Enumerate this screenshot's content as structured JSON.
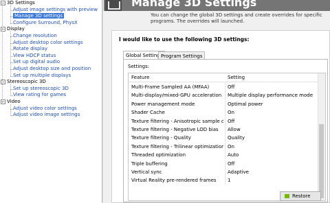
{
  "nav": {
    "categories": [
      {
        "label": "3D Settings",
        "items": [
          "Adjust image settings with preview",
          "Manage 3D settings",
          "Configure Surround, PhysX"
        ]
      },
      {
        "label": "Display",
        "items": [
          "Change resolution",
          "Adjust desktop color settings",
          "Rotate display",
          "View HDCP status",
          "Set up digital audio",
          "Adjust desktop size and position",
          "Set up multiple displays"
        ]
      },
      {
        "label": "Stereoscopic 3D",
        "items": [
          "Set up stereoscopic 3D",
          "View rating for games"
        ]
      },
      {
        "label": "Video",
        "items": [
          "Adjust video color settings",
          "Adjust video image settings"
        ]
      }
    ],
    "selected": "Manage 3D settings"
  },
  "header": {
    "title": "Manage 3D Settings",
    "description": "You can change the global 3D settings and create overrides for specific programs. The overrides will launched."
  },
  "panel": {
    "question": "I would like to use the following 3D settings:",
    "tabs": [
      "Global Settings",
      "Program Settings"
    ],
    "active_tab": "Global Settings",
    "settings_label": "Settings:",
    "columns": [
      "Feature",
      "Setting"
    ],
    "rows": [
      {
        "feature": "Multi-Frame Sampled AA (MFAA)",
        "setting": "Off"
      },
      {
        "feature": "Multi-display/mixed-GPU acceleration",
        "setting": "Multiple display performance mode"
      },
      {
        "feature": "Power management mode",
        "setting": "Optimal power"
      },
      {
        "feature": "Shader Cache",
        "setting": "On"
      },
      {
        "feature": "Texture filtering - Anisotropic sample opti...",
        "setting": "Off"
      },
      {
        "feature": "Texture filtering - Negative LOD bias",
        "setting": "Allow"
      },
      {
        "feature": "Texture filtering - Quality",
        "setting": "Quality"
      },
      {
        "feature": "Texture filtering - Trilinear optimization",
        "setting": "On"
      },
      {
        "feature": "Threaded optimization",
        "setting": "Auto"
      },
      {
        "feature": "Triple buffering",
        "setting": "Off"
      },
      {
        "feature": "Vertical sync",
        "setting": "Adaptive"
      },
      {
        "feature": "Virtual Reality pre-rendered frames",
        "setting": "1"
      }
    ],
    "restore_label": "Restore"
  },
  "colors": {
    "selection": "#3b78d8",
    "link": "#1d4fb0",
    "header": "#757575",
    "nvidia_green": "#76b900"
  }
}
